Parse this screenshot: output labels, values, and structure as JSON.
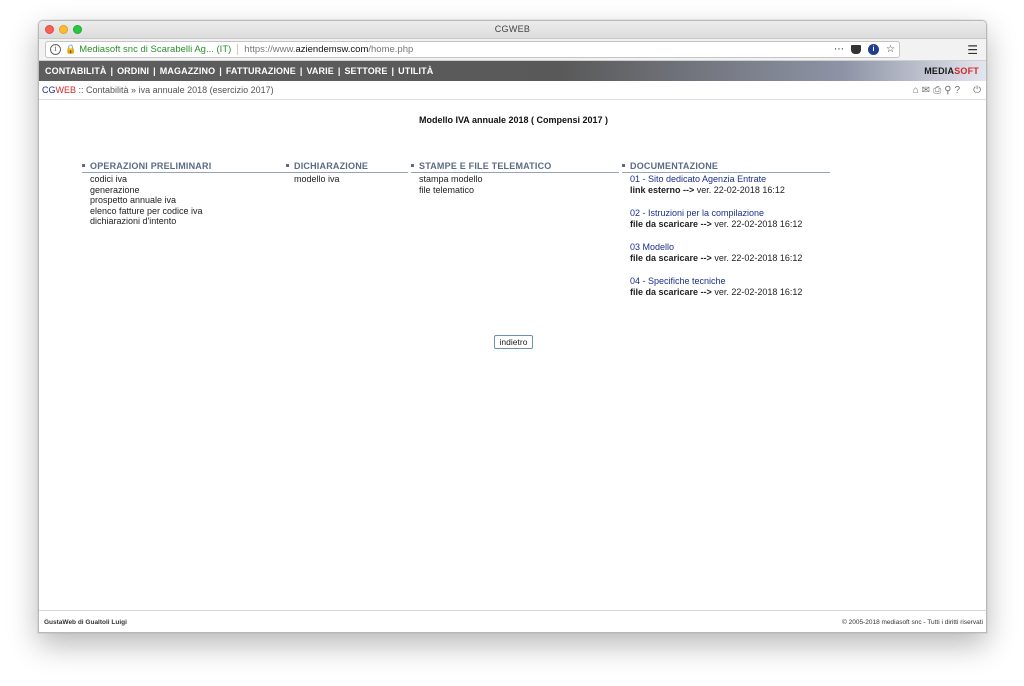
{
  "window": {
    "title": "CGWEB"
  },
  "browser": {
    "site_identity": "Mediasoft snc di Scarabelli Ag... (IT)",
    "url_prefix": "https://www.",
    "url_domain": "aziendemsw.com",
    "url_path": "/home.php",
    "icons": [
      "info-icon",
      "lock-icon",
      "more-icon",
      "pocket-icon",
      "extension-icon",
      "bookmark-star-icon",
      "hamburger-menu-icon"
    ]
  },
  "nav": {
    "items": [
      "CONTABILITÀ",
      "ORDINI",
      "MAGAZZINO",
      "FATTURAZIONE",
      "VARIE",
      "SETTORE",
      "UTILITÀ"
    ],
    "separator": "|",
    "brand_part1": "MEDIA",
    "brand_part2": "SOFT",
    "brand_colors": {
      "part1": "#1a1a1a",
      "part2": "#d22a2a"
    }
  },
  "breadcrumb": {
    "app_part1": "CG",
    "app_part2": "WEB",
    "separator": " :: ",
    "path": "Contabilità » iva annuale 2018 (esercizio 2017)",
    "tools": [
      "home-icon",
      "mail-icon",
      "print-icon",
      "search-icon",
      "help-icon",
      "power-icon"
    ]
  },
  "page": {
    "title": "Modello IVA annuale 2018 ( Compensi 2017 )",
    "back_label": "indietro"
  },
  "sections": {
    "preliminari": {
      "heading": "OPERAZIONI PRELIMINARI",
      "items": [
        "codici iva",
        "generazione",
        "prospetto annuale iva",
        "elenco fatture per codice iva",
        "dichiarazioni d'intento"
      ]
    },
    "dichiarazione": {
      "heading": "DICHIARAZIONE",
      "items": [
        "modello iva"
      ]
    },
    "stampe": {
      "heading": "STAMPE E FILE TELEMATICO",
      "items": [
        "stampa modello",
        "file telematico"
      ]
    },
    "documentazione": {
      "heading": "DOCUMENTAZIONE",
      "docs": [
        {
          "link": "01 - Sito dedicato Agenzia Entrate",
          "kind": "link esterno -->",
          "version": "ver. 22-02-2018 16:12"
        },
        {
          "link": "02 - Istruzioni per la compilazione",
          "kind": "file da scaricare -->",
          "version": "ver. 22-02-2018 16:12"
        },
        {
          "link": "03 Modello",
          "kind": "file da scaricare -->",
          "version": "ver. 22-02-2018 16:12"
        },
        {
          "link": "04 - Specifiche tecniche",
          "kind": "file da scaricare -->",
          "version": "ver. 22-02-2018 16:12"
        }
      ]
    }
  },
  "footer": {
    "left": "GustaWeb di Gualtoli Luigi",
    "right": "© 2005-2018 mediasoft snc - Tutti i diritti riservati"
  }
}
